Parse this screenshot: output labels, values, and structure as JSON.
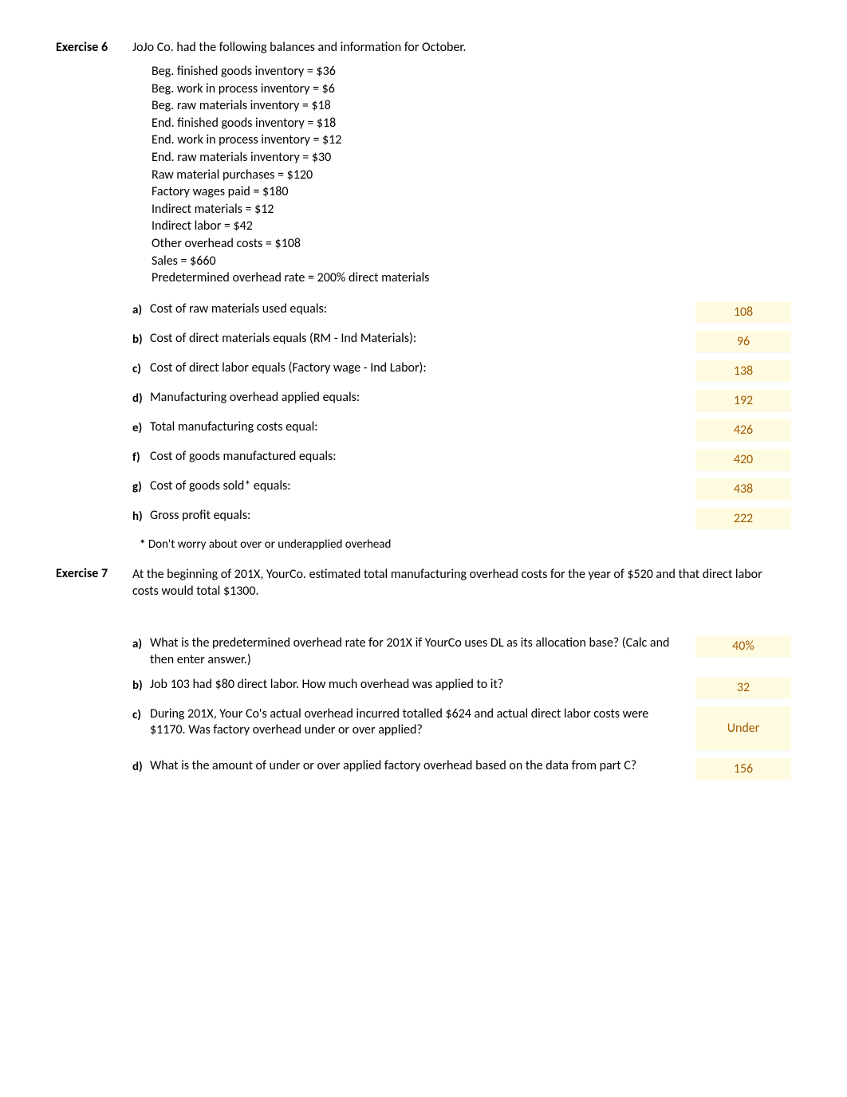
{
  "exercise6": {
    "label": "Exercise 6",
    "intro": "JoJo Co. had the following balances and information for October.",
    "info": [
      "Beg. finished goods inventory = $36",
      "Beg. work in process inventory = $6",
      "Beg. raw materials inventory = $18",
      "End. finished goods inventory = $18",
      "End. work in process inventory = $12",
      "End. raw materials inventory = $30",
      "Raw material purchases = $120",
      "Factory wages paid = $180",
      "Indirect materials = $12",
      "Indirect labor = $42",
      "Other overhead costs = $108",
      "Sales = $660",
      "Predetermined overhead rate = 200% direct materials"
    ],
    "questions": [
      {
        "label": "a)",
        "text": "Cost of raw materials used equals:",
        "answer": "108"
      },
      {
        "label": "b)",
        "text": "Cost of direct materials equals (RM - Ind Materials):",
        "answer": "96"
      },
      {
        "label": "c)",
        "text": "Cost of direct labor equals (Factory wage - Ind Labor):",
        "answer": "138"
      },
      {
        "label": "d)",
        "text": "Manufacturing overhead applied equals:",
        "answer": "192"
      },
      {
        "label": "e)",
        "text": "Total manufacturing costs equal:",
        "answer": "426"
      },
      {
        "label": "f)",
        "text": "Cost of goods manufactured equals:",
        "answer": "420"
      },
      {
        "label": "g)",
        "text": "Cost of goods sold* equals:",
        "answer": "438"
      },
      {
        "label": "h)",
        "text": "Gross profit equals:",
        "answer": "222"
      }
    ],
    "footnote_star": "*",
    "footnote": "Don't worry about over or underapplied overhead"
  },
  "exercise7": {
    "label": "Exercise 7",
    "intro": "At the beginning of 201X, YourCo. estimated total manufacturing overhead costs for the year of $520 and that direct labor costs would total $1300.",
    "questions": [
      {
        "label": "a)",
        "text": "What is the predetermined overhead rate for 201X if YourCo uses DL as its allocation base?  (Calc and then enter answer.)",
        "answer": "40%",
        "tall": false
      },
      {
        "label": "b)",
        "text": "Job 103 had $80 direct labor. How much overhead was applied to it?",
        "answer": "32",
        "tall": false
      },
      {
        "label": "c)",
        "text": "During 201X, Your Co's actual overhead incurred totalled $624 and actual direct labor costs were $1170.  Was factory overhead under or over applied?",
        "answer": "Under",
        "tall": true
      },
      {
        "label": "d)",
        "text": "What is the amount of under or over applied factory overhead based on the data from part C?",
        "answer": "156",
        "tall": false
      }
    ]
  }
}
